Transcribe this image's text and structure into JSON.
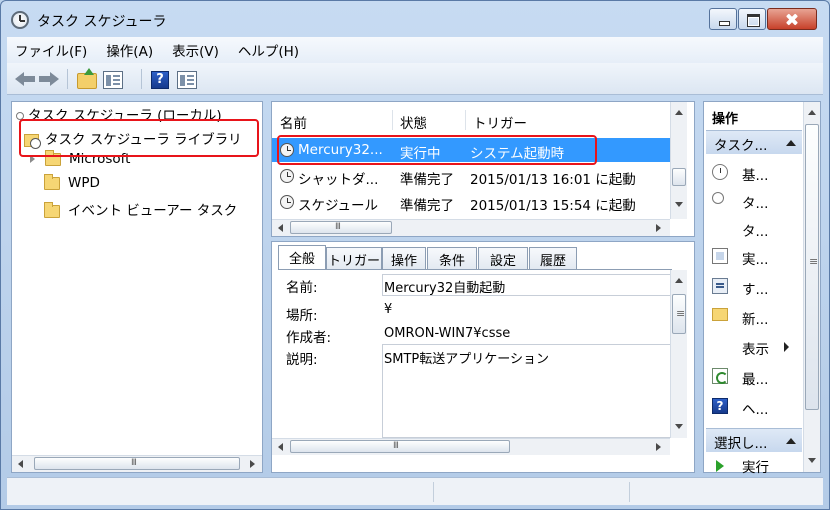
{
  "window": {
    "title": "タスク スケジューラ"
  },
  "menu": [
    "ファイル(F)",
    "操作(A)",
    "表示(V)",
    "ヘルプ(H)"
  ],
  "toolbar": {
    "help_glyph": "?"
  },
  "tree": {
    "root": "タスク スケジューラ (ローカル)",
    "library": "タスク スケジューラ ライブラリ",
    "children": [
      "Microsoft",
      "WPD",
      "イベント ビューアー タスク"
    ]
  },
  "task_list": {
    "columns": [
      "名前",
      "状態",
      "トリガー"
    ],
    "rows": [
      {
        "name": "Mercury32...",
        "status": "実行中",
        "trigger": "システム起動時"
      },
      {
        "name": "シャットダ...",
        "status": "準備完了",
        "trigger": "2015/01/13 16:01 に起動"
      },
      {
        "name": "スケジュール",
        "status": "準備完了",
        "trigger": "2015/01/13 15:54 に起動"
      }
    ]
  },
  "detail": {
    "tabs": [
      "全般",
      "トリガー",
      "操作",
      "条件",
      "設定",
      "履歴"
    ],
    "fields": {
      "name_label": "名前:",
      "name_value": "Mercury32自動起動",
      "location_label": "場所:",
      "location_value": "¥",
      "author_label": "作成者:",
      "author_value": "OMRON-WIN7¥csse",
      "description_label": "説明:",
      "description_value": "SMTP転送アプリケーション"
    }
  },
  "actions": {
    "title": "操作",
    "section1": "タスク...",
    "items": [
      "基...",
      "タ...",
      "タ...",
      "実...",
      "す...",
      "新...",
      "表示",
      "最...",
      "ヘ..."
    ],
    "section2": "選択し...",
    "next_item": "実行"
  },
  "scroll": {
    "grip": "III",
    "vgrip": "≡"
  },
  "colors": {
    "selection": "#3399ff",
    "highlight_box": "#e8141a"
  }
}
